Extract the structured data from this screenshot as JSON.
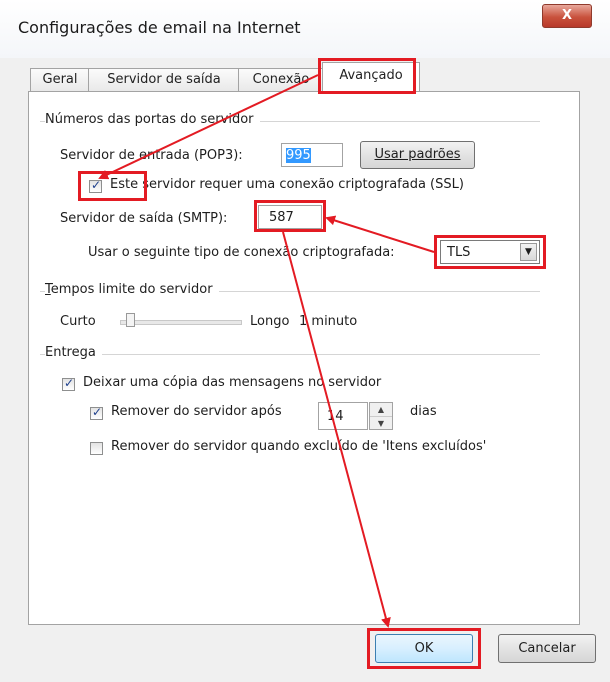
{
  "window": {
    "title": "Configurações de email na Internet",
    "close_glyph": "X"
  },
  "tabs": [
    {
      "label": "Geral"
    },
    {
      "label": "Servidor de saída"
    },
    {
      "label": "Conexão"
    },
    {
      "label": "Avançado"
    }
  ],
  "ports": {
    "group_label": "Números das portas do servidor",
    "incoming_label": "Servidor de entrada (POP3):",
    "incoming_value": "995",
    "defaults_button": "Usar padrões",
    "ssl_checkbox_label": "Este servidor requer uma conexão criptografada (SSL)",
    "ssl_checked": true,
    "outgoing_label": "Servidor de saída (SMTP):",
    "outgoing_value": "587",
    "encryption_label": "Usar o seguinte tipo de conexão criptografada:",
    "encryption_value": "TLS"
  },
  "timeouts": {
    "group_label": "Tempos limite do servidor",
    "short_label": "Curto",
    "long_label": "Longo",
    "value_text": "1 minuto"
  },
  "delivery": {
    "group_label": "Entrega",
    "keep_copy_label": "Deixar uma cópia das mensagens no servidor",
    "keep_copy_checked": true,
    "remove_after_label": "Remover do servidor após",
    "remove_after_checked": true,
    "remove_after_days": "14",
    "days_label": "dias",
    "remove_deleted_label": "Remover do servidor quando excluído de 'Itens excluídos'",
    "remove_deleted_checked": false
  },
  "footer": {
    "ok_label": "OK",
    "cancel_label": "Cancelar"
  },
  "colors": {
    "annotation_red": "#e31b23",
    "selection_blue": "#3399ff"
  }
}
